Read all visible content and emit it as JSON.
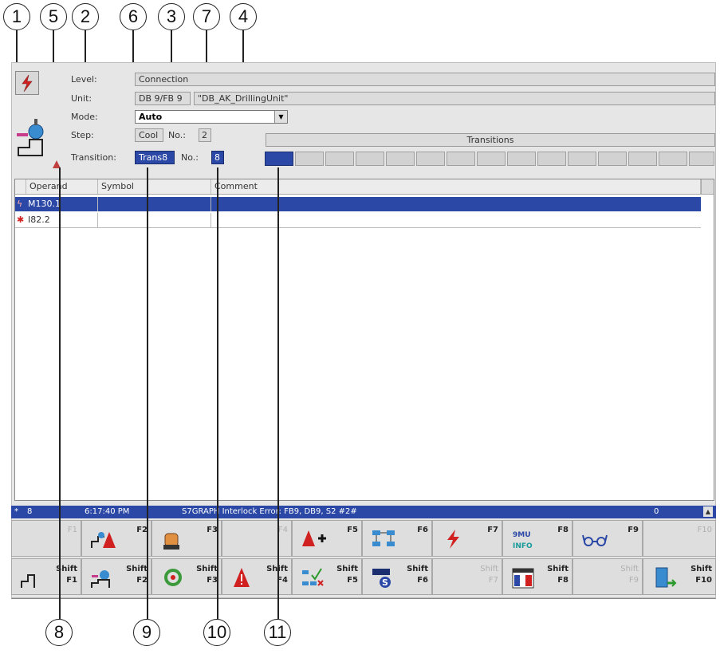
{
  "callouts_top": [
    "1",
    "5",
    "2",
    "6",
    "3",
    "7",
    "4"
  ],
  "callouts_bottom": [
    "8",
    "9",
    "10",
    "11"
  ],
  "form": {
    "level_label": "Level:",
    "level_value": "Connection",
    "unit_label": "Unit:",
    "unit_db": "DB 9/FB 9",
    "unit_name": "\"DB_AK_DrillingUnit\"",
    "mode_label": "Mode:",
    "mode_value": "Auto",
    "step_label": "Step:",
    "step_value": "Cool",
    "step_no_label": "No.:",
    "step_no_value": "2",
    "transition_label": "Transition:",
    "transition_value": "Trans8",
    "transition_no_label": "No.:",
    "transition_no_value": "8",
    "transitions_header": "Transitions",
    "transitions_active_index": 1
  },
  "table": {
    "columns": [
      "Operand",
      "Symbol",
      "Comment"
    ],
    "rows": [
      {
        "operand": "M130.1",
        "symbol": "",
        "comment": "",
        "selected": true
      },
      {
        "operand": "I82.2",
        "symbol": "",
        "comment": "",
        "selected": false
      }
    ]
  },
  "status": {
    "count": "8",
    "time": "6:17:40 PM",
    "message": "S7GRAPH Interlock Error: FB9, DB9, S2  #2#",
    "right_value": "0"
  },
  "fkeys_row1": [
    {
      "label": "F1",
      "enabled": false,
      "icon": "blank"
    },
    {
      "label": "F2",
      "enabled": true,
      "icon": "step-alarm-icon"
    },
    {
      "label": "F3",
      "enabled": true,
      "icon": "hand-icon"
    },
    {
      "label": "F4",
      "enabled": false,
      "icon": "blank"
    },
    {
      "label": "F5",
      "enabled": true,
      "icon": "alarm-add-icon"
    },
    {
      "label": "F6",
      "enabled": true,
      "icon": "network-icon"
    },
    {
      "label": "F7",
      "enabled": true,
      "icon": "lightning-icon"
    },
    {
      "label": "F8",
      "enabled": true,
      "icon": "info-icon"
    },
    {
      "label": "F9",
      "enabled": true,
      "icon": "glasses-icon"
    },
    {
      "label": "F10",
      "enabled": false,
      "icon": "blank"
    }
  ],
  "fkeys_row2": [
    {
      "shift": "Shift",
      "label": "F1",
      "enabled": true,
      "icon": "stairs-icon"
    },
    {
      "shift": "Shift",
      "label": "F2",
      "enabled": true,
      "icon": "sequencer-icon"
    },
    {
      "shift": "Shift",
      "label": "F3",
      "enabled": true,
      "icon": "cycle-icon"
    },
    {
      "shift": "Shift",
      "label": "F4",
      "enabled": true,
      "icon": "alarm-icon"
    },
    {
      "shift": "Shift",
      "label": "F5",
      "enabled": true,
      "icon": "check-network-icon"
    },
    {
      "shift": "Shift",
      "label": "F6",
      "enabled": true,
      "icon": "s-module-icon"
    },
    {
      "shift": "Shift",
      "label": "F7",
      "enabled": false,
      "icon": "blank"
    },
    {
      "shift": "Shift",
      "label": "F8",
      "enabled": true,
      "icon": "flag-window-icon"
    },
    {
      "shift": "Shift",
      "label": "F9",
      "enabled": false,
      "icon": "blank"
    },
    {
      "shift": "Shift",
      "label": "F10",
      "enabled": true,
      "icon": "exit-door-icon"
    }
  ],
  "colors": {
    "accent_blue": "#2b48a6",
    "alarm_red": "#d02020",
    "panel_grey": "#e6e6e6"
  }
}
